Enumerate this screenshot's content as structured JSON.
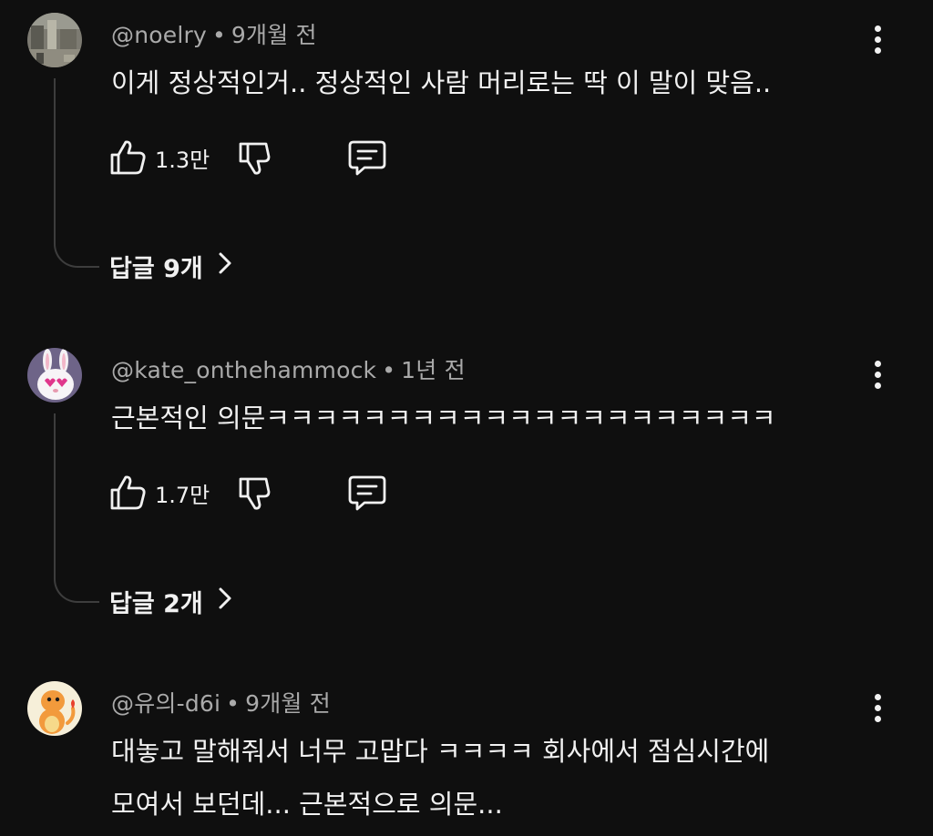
{
  "comments": [
    {
      "author": "@noelry",
      "time": "9개월 전",
      "lines": [
        "이게 정상적인거.. 정상적인 사람 머리로는 딱 이 말이 맞음.."
      ],
      "likes": "1.3만",
      "replies_label": "답글 9개",
      "avatar_icon": "photo-avatar"
    },
    {
      "author": "@kate_onthehammock",
      "time": "1년 전",
      "lines": [
        "근본적인 의문ㅋㅋㅋㅋㅋㅋㅋㅋㅋㅋㅋㅋㅋㅋㅋㅋㅋㅋㅋㅋㅋ"
      ],
      "likes": "1.7만",
      "replies_label": "답글 2개",
      "avatar_icon": "rabbit-avatar"
    },
    {
      "author": "@유의-d6i",
      "time": "9개월 전",
      "lines": [
        "대놓고 말해줘서 너무 고맙다 ㅋㅋㅋㅋ 회사에서 점심시간에",
        "모여서 보던데... 근본적으로 의문..."
      ],
      "avatar_icon": "charmander-avatar"
    }
  ],
  "separator": "•",
  "icons": {
    "like": "thumb-up-icon",
    "dislike": "thumb-down-icon",
    "reply": "reply-comment-icon",
    "more": "more-vertical-icon",
    "chevron": "chevron-right-icon"
  },
  "colors": {
    "background": "#0f0f0f",
    "text": "#f1f1f1",
    "meta": "#aaaaaa",
    "thread_line": "#3d3d3d"
  }
}
